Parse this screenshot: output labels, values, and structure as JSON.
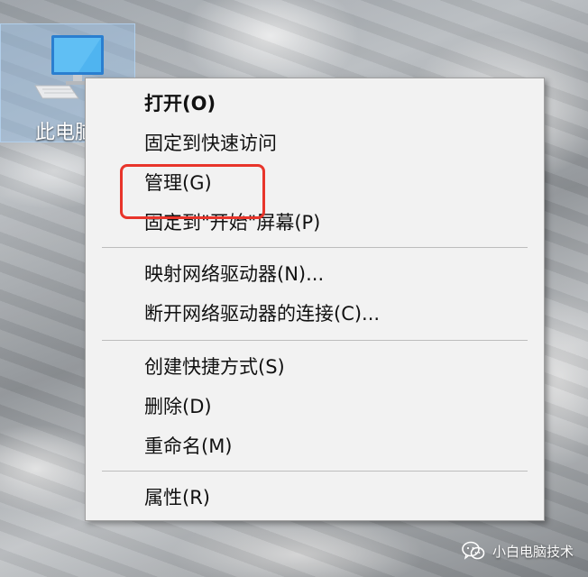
{
  "desktop": {
    "icon_label": "此电脑"
  },
  "context_menu": {
    "items": [
      {
        "label": "打开(O)",
        "bold": true
      },
      {
        "label": "固定到快速访问"
      },
      {
        "label": "管理(G)",
        "highlighted": true
      },
      {
        "label": "固定到\"开始\"屏幕(P)"
      },
      {
        "label": "映射网络驱动器(N)..."
      },
      {
        "label": "断开网络驱动器的连接(C)..."
      },
      {
        "label": "创建快捷方式(S)"
      },
      {
        "label": "删除(D)"
      },
      {
        "label": "重命名(M)"
      },
      {
        "label": "属性(R)"
      }
    ]
  },
  "annotation": {
    "highlight_color": "#e8352b"
  },
  "watermark": {
    "text": "小白电脑技术",
    "icon": "wechat-icon"
  }
}
